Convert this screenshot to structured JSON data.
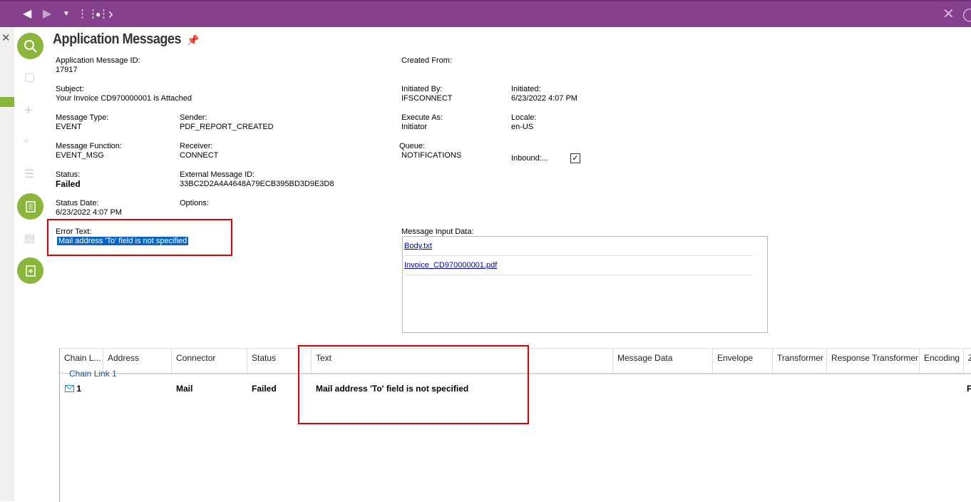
{
  "topbar": {
    "back_icon": "arrow-left-icon",
    "forward_icon": "arrow-right-icon",
    "dropdown_icon": "caret-down-icon",
    "apps_icon": "grid-icon",
    "dot_icon": "dot-icon",
    "chevron_icon": "chevron-right-icon",
    "close_icon": "close-icon",
    "color": "#85408e"
  },
  "page": {
    "title": "Application Messages"
  },
  "fields": {
    "app_msg_id_label": "Application Message ID:",
    "app_msg_id": "17917",
    "created_from_label": "Created From:",
    "subject_label": "Subject:",
    "subject": "Your Invoice CD970000001 is Attached",
    "initiated_by_label": "Initiated By:",
    "initiated_by": "IFSCONNECT",
    "initiated_label": "Initiated:",
    "initiated": "6/23/2022 4:07 PM",
    "message_type_label": "Message Type:",
    "message_type": "EVENT",
    "sender_label": "Sender:",
    "sender": "PDF_REPORT_CREATED",
    "execute_as_label": "Execute As:",
    "execute_as": "Initiator",
    "locale_label": "Locale:",
    "locale": "en-US",
    "message_function_label": "Message Function:",
    "message_function": "EVENT_MSG",
    "receiver_label": "Receiver:",
    "receiver": "CONNECT",
    "queue_label": "Queue:",
    "queue": "NOTIFICATIONS",
    "inbound_label": "Inbound:...",
    "inbound_checked": true,
    "status_label": "Status:",
    "status": "Failed",
    "external_msg_id_label": "External Message ID:",
    "external_msg_id": "33BC2D2A4A4648A79ECB395BD3D9E3D8",
    "status_date_label": "Status Date:",
    "status_date": "6/23/2022 4:07 PM",
    "options_label": "Options:",
    "error_text_label": "Error Text:",
    "error_text": "Mail address 'To' field is not specified",
    "message_input_label": "Message Input Data:",
    "files": [
      "Body.txt",
      "Invoice_CD970000001.pdf"
    ]
  },
  "grid": {
    "columns": [
      "Chain L...",
      "Address",
      "Connector",
      "Status",
      "Text",
      "Message Data",
      "Envelope",
      "Transformer",
      "Response Transformer",
      "Encoding",
      "Z"
    ],
    "group_label": "Chain Link 1",
    "row": {
      "chain_link": "1",
      "address": "",
      "connector": "Mail",
      "status": "Failed",
      "text": "Mail address 'To' field is not specified",
      "trailing": "F"
    }
  }
}
